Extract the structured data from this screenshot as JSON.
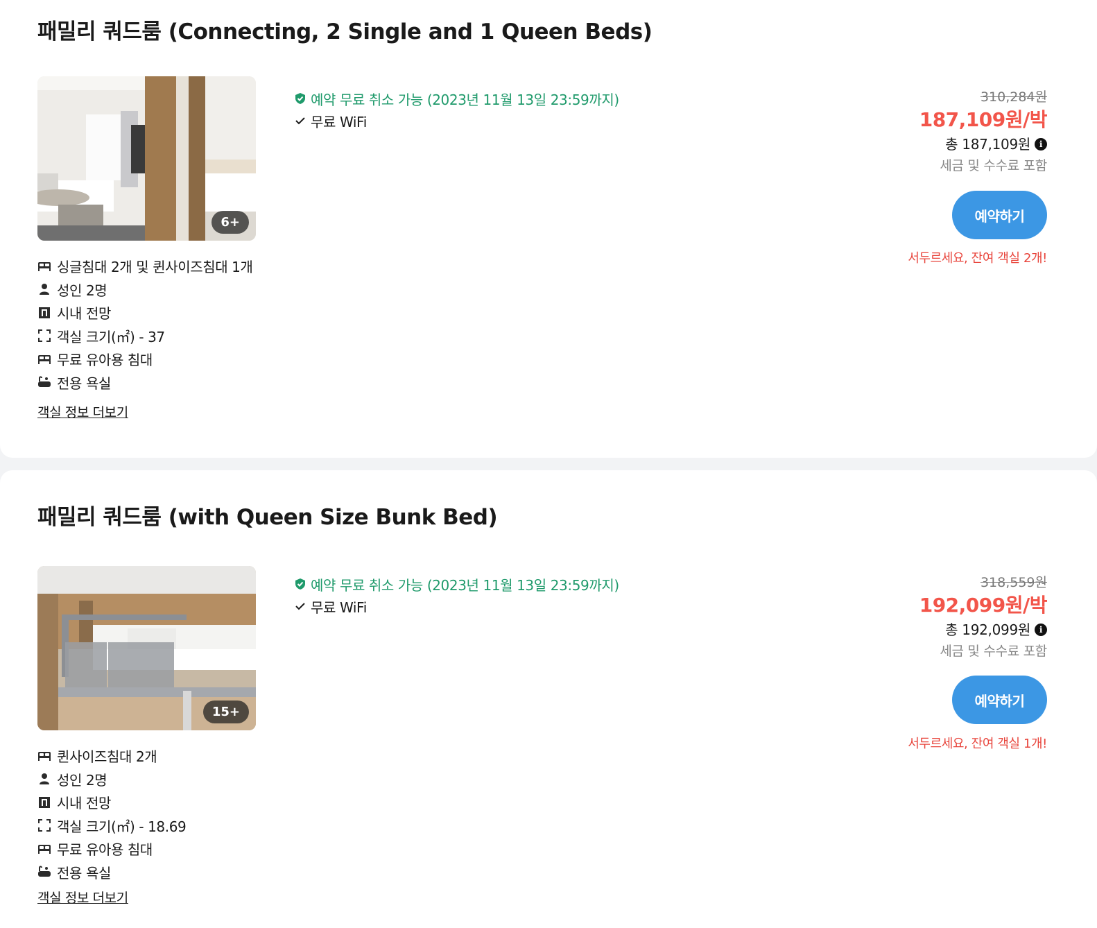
{
  "rooms": [
    {
      "title": "패밀리 쿼드룸 (Connecting, 2 Single and 1 Queen Beds)",
      "photo_count": "6+",
      "amenities": [
        {
          "icon": "bed-icon",
          "label": "싱글침대 2개 및 퀸사이즈침대 1개"
        },
        {
          "icon": "person-icon",
          "label": "성인 2명"
        },
        {
          "icon": "city-view-icon",
          "label": "시내 전망"
        },
        {
          "icon": "room-size-icon",
          "label": "객실 크기(㎡) - 37"
        },
        {
          "icon": "bed-icon",
          "label": "무료 유아용 침대"
        },
        {
          "icon": "bathtub-icon",
          "label": "전용 욕실"
        }
      ],
      "more_link": "객실 정보 더보기",
      "free_cancel": "예약 무료 취소 가능 (2023년 11월 13일 23:59까지)",
      "wifi": "무료 WiFi",
      "original_price": "310,284원",
      "price_per_night": "187,109원/박",
      "total_price": "총 187,109원",
      "tax_note": "세금 및 수수료 포함",
      "book_label": "예약하기",
      "scarcity": "서두르세요, 잔여 객실 2개!"
    },
    {
      "title": "패밀리 쿼드룸 (with Queen Size Bunk Bed)",
      "photo_count": "15+",
      "amenities": [
        {
          "icon": "bed-icon",
          "label": "퀸사이즈침대 2개"
        },
        {
          "icon": "person-icon",
          "label": "성인 2명"
        },
        {
          "icon": "city-view-icon",
          "label": "시내 전망"
        },
        {
          "icon": "room-size-icon",
          "label": "객실 크기(㎡) - 18.69"
        },
        {
          "icon": "bed-icon",
          "label": "무료 유아용 침대"
        },
        {
          "icon": "bathtub-icon",
          "label": "전용 욕실"
        }
      ],
      "more_link": "객실 정보 더보기",
      "free_cancel": "예약 무료 취소 가능 (2023년 11월 13일 23:59까지)",
      "wifi": "무료 WiFi",
      "original_price": "318,559원",
      "price_per_night": "192,099원/박",
      "total_price": "총 192,099원",
      "tax_note": "세금 및 수수료 포함",
      "book_label": "예약하기",
      "scarcity": "서두르세요, 잔여 객실 1개!"
    }
  ],
  "colors": {
    "accent_blue": "#3c97e4",
    "price_red": "#f2554a",
    "cancel_green": "#1f9a6b"
  }
}
